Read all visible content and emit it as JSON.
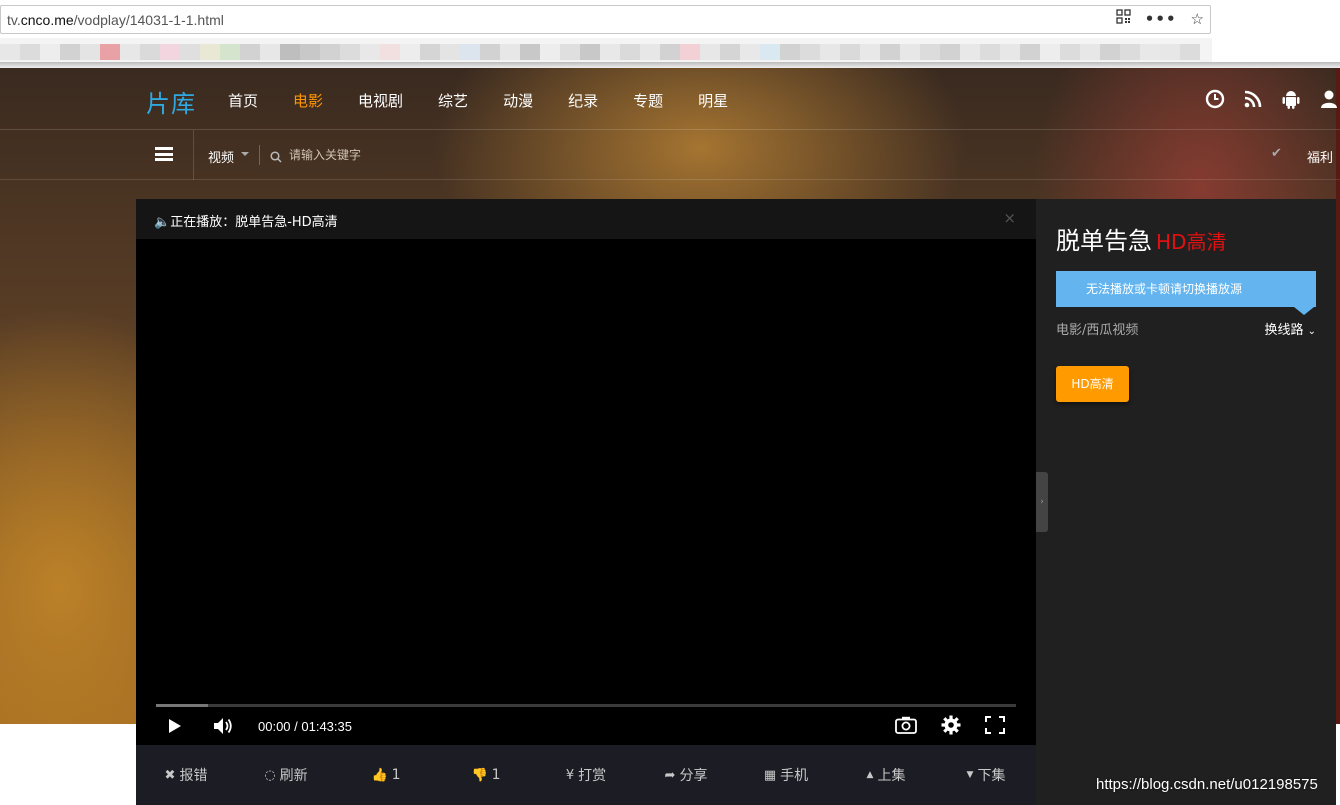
{
  "browser": {
    "url_prefix": "tv.",
    "url_domain": "cnco.me",
    "url_path": "/vodplay/14031-1-1.html",
    "icons": [
      "qr-code-icon",
      "more-icon",
      "star-icon"
    ]
  },
  "nav": {
    "logo": "片库",
    "items": [
      {
        "label": "首页",
        "active": false
      },
      {
        "label": "电影",
        "active": true
      },
      {
        "label": "电视剧",
        "active": false
      },
      {
        "label": "综艺",
        "active": false
      },
      {
        "label": "动漫",
        "active": false
      },
      {
        "label": "纪录",
        "active": false
      },
      {
        "label": "专题",
        "active": false
      },
      {
        "label": "明星",
        "active": false
      }
    ],
    "right_icons": [
      "clock-icon",
      "rss-icon",
      "android-icon",
      "user-icon"
    ]
  },
  "subnav": {
    "scope": "视频",
    "search_placeholder": "请输入关键字",
    "fuli": "福利"
  },
  "player": {
    "now_playing": "正在播放：脱单告急-HD高清",
    "close": "×",
    "time": "00:00 / 01:43:35",
    "buffered": 0.06
  },
  "actions": [
    {
      "icon": "✖",
      "label": "报错",
      "name": "report-error"
    },
    {
      "icon": "◌",
      "label": "刷新",
      "name": "refresh"
    },
    {
      "icon": "👍",
      "label": "1",
      "name": "like"
    },
    {
      "icon": "👎",
      "label": "1",
      "name": "dislike"
    },
    {
      "icon": "¥",
      "label": "打赏",
      "name": "tip"
    },
    {
      "icon": "➦",
      "label": "分享",
      "name": "share"
    },
    {
      "icon": "▦",
      "label": "手机",
      "name": "mobile"
    },
    {
      "icon": "▲",
      "label": "上集",
      "name": "prev-episode"
    },
    {
      "icon": "▼",
      "label": "下集",
      "name": "next-episode"
    }
  ],
  "side": {
    "title": "脱单告急",
    "quality": "HD高清",
    "tip": "无法播放或卡顿请切换播放源",
    "source": "电影/西瓜视频",
    "switch_line": "换线路",
    "episode": "HD高清"
  },
  "watermark": "https://blog.csdn.net/u012198575",
  "colors": {
    "accent": "#ff9500",
    "logo": "#2fa9e0",
    "hd_red": "#e21010",
    "tip_blue": "#63b4ef"
  }
}
